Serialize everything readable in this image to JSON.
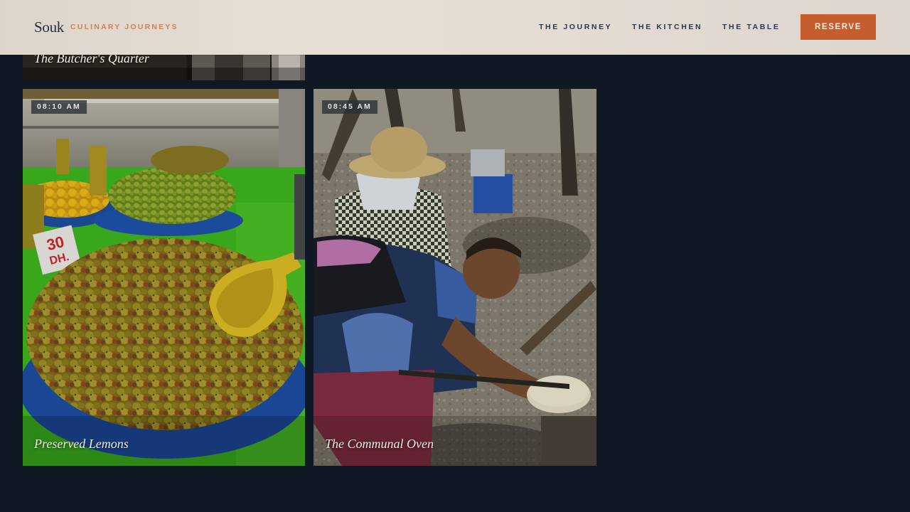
{
  "header": {
    "brand": "Souk",
    "tagline": "CULINARY JOURNEYS",
    "nav": [
      {
        "label": "THE JOURNEY"
      },
      {
        "label": "THE KITCHEN"
      },
      {
        "label": "THE TABLE"
      }
    ],
    "cta_label": "RESERVE"
  },
  "gallery": {
    "cards": [
      {
        "caption": "The Butcher's Quarter",
        "time": ""
      },
      {
        "caption": "Preserved Lemons",
        "time": "08:10 AM",
        "sign_text": "30 DH."
      },
      {
        "caption": "The Communal Oven",
        "time": "08:45 AM"
      }
    ]
  },
  "colors": {
    "page_background": "#101823",
    "header_background": "#e4dcd3",
    "accent": "#c55d2c",
    "tagline": "#c8825a",
    "nav_text": "#2b3650"
  }
}
